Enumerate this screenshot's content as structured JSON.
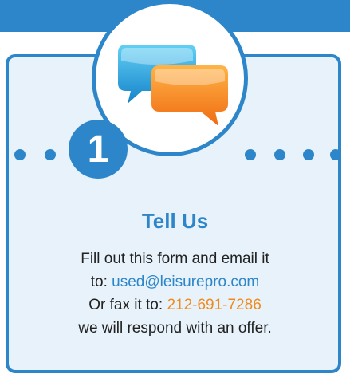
{
  "step": {
    "number": "1",
    "title": "Tell Us"
  },
  "message": {
    "line1": "Fill out this form and email it",
    "line2_prefix": "to: ",
    "email": "used@leisurepro.com",
    "line3_prefix": "Or fax it to: ",
    "fax": "212-691-7286",
    "line4": "we will respond with an offer."
  },
  "icons": {
    "medallion_icon": "chat-bubbles-icon"
  },
  "colors": {
    "primary_blue": "#2d86c9",
    "card_background": "#e8f2fa",
    "accent_orange": "#f08a1a",
    "chat_blue": "#1a9fe0",
    "chat_orange": "#f07f1b"
  }
}
